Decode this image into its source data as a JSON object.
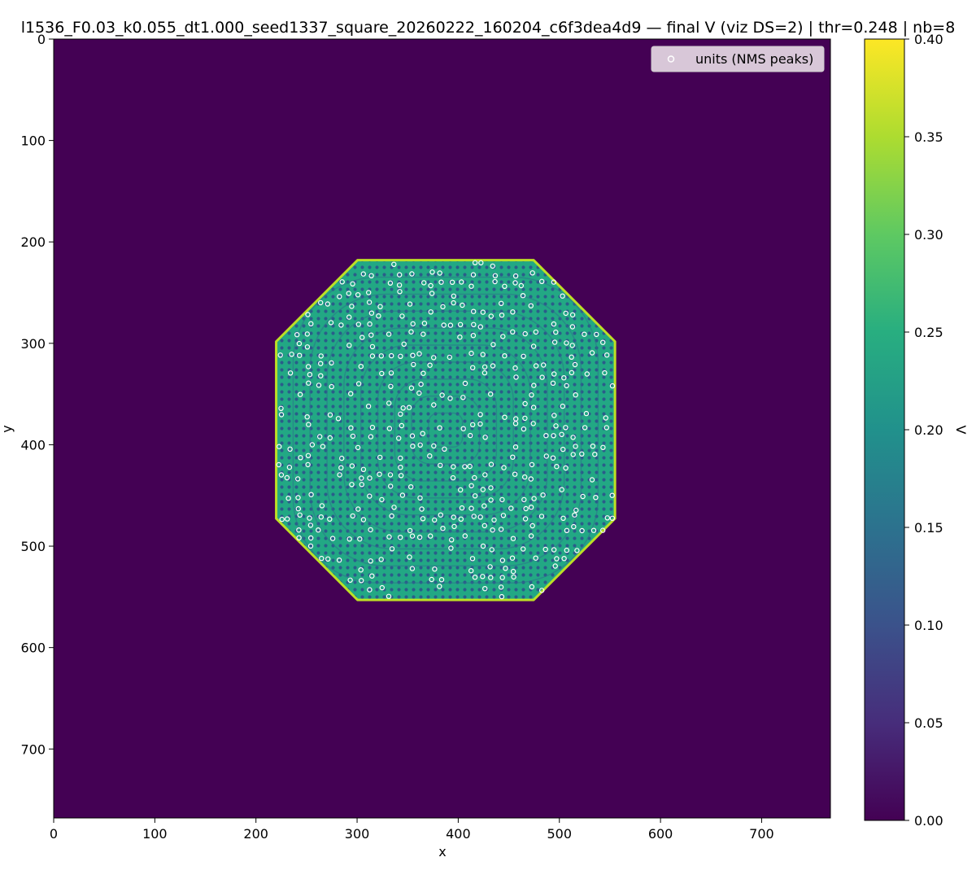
{
  "chart_data": {
    "type": "heatmap",
    "title": "l1536_F0.03_k0.055_dt1.000_seed1337_square_20260222_160204_c6f3dea4d9 — final V (viz DS=2) | thr=0.248 | nb=8",
    "xlabel": "x",
    "ylabel": "y",
    "xlim": [
      0,
      768
    ],
    "ylim": [
      768,
      0
    ],
    "x_ticks": [
      0,
      100,
      200,
      300,
      400,
      500,
      600,
      700
    ],
    "y_ticks": [
      0,
      100,
      200,
      300,
      400,
      500,
      600,
      700
    ],
    "background_value": 0.0,
    "pattern_region": {
      "shape": "rounded square (octagon-like) blob of spots and stripes",
      "x_range": [
        220,
        555
      ],
      "y_range": [
        218,
        553
      ],
      "mean_value": 0.22
    },
    "units_marker": "white hollow circle",
    "legend": {
      "label": "units (NMS peaks)",
      "position": "upper right"
    },
    "colorbar": {
      "label": "V",
      "colormap": "viridis",
      "range": [
        0.0,
        0.4
      ],
      "ticks": [
        "0.00",
        "0.05",
        "0.10",
        "0.15",
        "0.20",
        "0.25",
        "0.30",
        "0.35",
        "0.40"
      ]
    },
    "grid": false
  },
  "colors": {
    "background": "#440154",
    "pattern_dark": "#2f6b8e",
    "pattern_mid": "#21918c",
    "pattern_light": "#5ec962",
    "edge": "#bddf26",
    "marker": "#ffffff"
  }
}
